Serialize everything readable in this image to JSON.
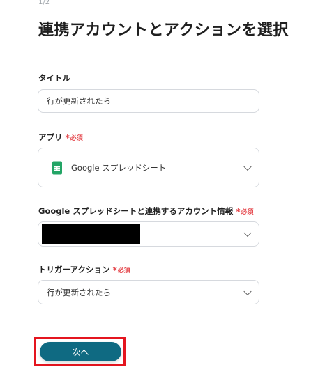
{
  "header": {
    "step": "1/2",
    "title": "連携アカウントとアクションを選択"
  },
  "form": {
    "title_field": {
      "label": "タイトル",
      "value": "行が更新されたら"
    },
    "app_field": {
      "label": "アプリ",
      "required": "必須",
      "value": "Google スプレッドシート",
      "icon": "google-sheets-icon"
    },
    "account_field": {
      "label": "Google スプレッドシートと連携するアカウント情報",
      "required": "必須"
    },
    "trigger_field": {
      "label": "トリガーアクション",
      "required": "必須",
      "value": "行が更新されたら"
    }
  },
  "actions": {
    "next_label": "次へ"
  },
  "colors": {
    "primary_button": "#0f6a82",
    "required_mark": "#e5484d",
    "highlight_border": "#e4151f",
    "sheets_green": "#23a566"
  }
}
